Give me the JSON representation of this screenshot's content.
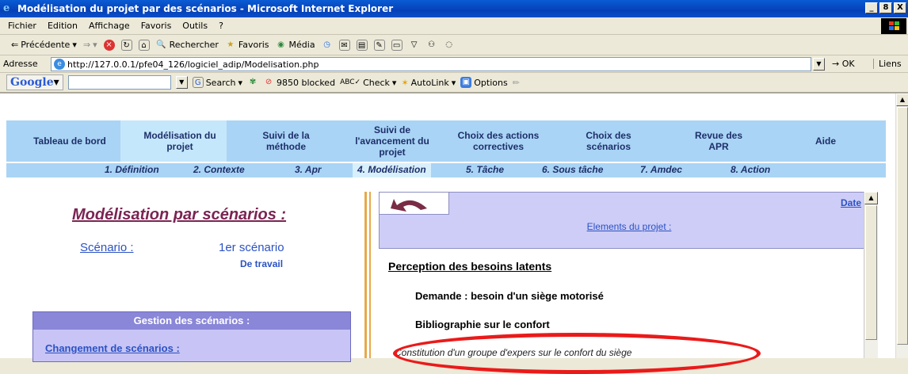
{
  "window": {
    "title": "Modélisation du projet par des scénarios - Microsoft Internet Explorer",
    "controls": [
      "_",
      "8",
      "X"
    ]
  },
  "menu": {
    "items": [
      "Fichier",
      "Edition",
      "Affichage",
      "Favoris",
      "Outils",
      "?"
    ]
  },
  "toolbar": {
    "back": "Précédente",
    "search": "Rechercher",
    "favorites": "Favoris",
    "media": "Média"
  },
  "address": {
    "label": "Adresse",
    "url": "http://127.0.0.1/pfe04_126/logiciel_adip/Modelisation.php",
    "go": "OK",
    "links": "Liens"
  },
  "google_bar": {
    "logo": "Google",
    "search": "Search",
    "blocked": "9850 blocked",
    "check": "Check",
    "autolink": "AutoLink",
    "options": "Options"
  },
  "nav": {
    "tabs": [
      "Tableau de bord",
      "Modélisation du projet",
      "Suivi de la méthode",
      "Suivi de l'avancement du projet",
      "Choix des actions correctives",
      "Choix des scénarios",
      "Revue des APR",
      "Aide"
    ],
    "subtabs": [
      "1. Définition",
      "2. Contexte",
      "3. Apr",
      "4. Modélisation",
      "5. Tâche",
      "6. Sous tâche",
      "7. Amdec",
      "8. Action"
    ]
  },
  "left": {
    "title": "Modélisation par scénarios :",
    "scenario_label": "Scénario :",
    "scenario_value": "1er scénario",
    "scenario_sub": "De travail",
    "gestion_header": "Gestion des scénarios :",
    "gestion_link": "Changement de scénarios :"
  },
  "right": {
    "project_link": "Elements du projet :",
    "date_link": "Date",
    "section_title": "Perception des besoins latents",
    "items": [
      "Demande : besoin d'un siège motorisé",
      "Bibliographie sur le confort",
      "Constitution d'un groupe d'expers sur le confort du siège"
    ]
  },
  "colors": {
    "tab_bg": "#a9d4f5",
    "tab_text": "#1e2f6a",
    "title_color": "#7b2452",
    "link_color": "#2b52c4",
    "panel_bg": "#cdcdf7",
    "annotation": "#ea1a1a"
  }
}
